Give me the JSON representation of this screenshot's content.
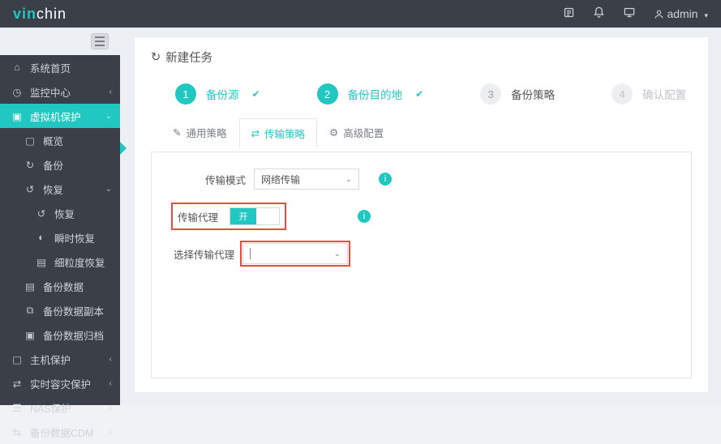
{
  "topbar": {
    "logo_prefix": "vin",
    "logo_suffix": "chin",
    "user_label": "admin"
  },
  "sidebar": {
    "items": [
      {
        "label": "系统首页"
      },
      {
        "label": "监控中心"
      },
      {
        "label": "虚拟机保护"
      },
      {
        "label": "概览"
      },
      {
        "label": "备份"
      },
      {
        "label": "恢复"
      },
      {
        "label": "恢复"
      },
      {
        "label": "瞬时恢复"
      },
      {
        "label": "细粒度恢复"
      },
      {
        "label": "备份数据"
      },
      {
        "label": "备份数据副本"
      },
      {
        "label": "备份数据归档"
      },
      {
        "label": "主机保护"
      },
      {
        "label": "实时容灾保护"
      },
      {
        "label": "NAS保护"
      },
      {
        "label": "备份数据CDM"
      }
    ]
  },
  "page": {
    "title": "新建任务",
    "steps": [
      {
        "num": "1",
        "label": "备份源"
      },
      {
        "num": "2",
        "label": "备份目的地"
      },
      {
        "num": "3",
        "label": "备份策略"
      },
      {
        "num": "4",
        "label": "确认配置"
      }
    ],
    "subtabs": [
      {
        "label": "通用策略"
      },
      {
        "label": "传输策略"
      },
      {
        "label": "高级配置"
      }
    ],
    "form": {
      "transfer_mode_label": "传输模式",
      "transfer_mode_value": "网络传输",
      "proxy_label": "传输代理",
      "proxy_toggle_on": "开",
      "select_proxy_label": "选择传输代理",
      "select_proxy_value": ""
    }
  }
}
